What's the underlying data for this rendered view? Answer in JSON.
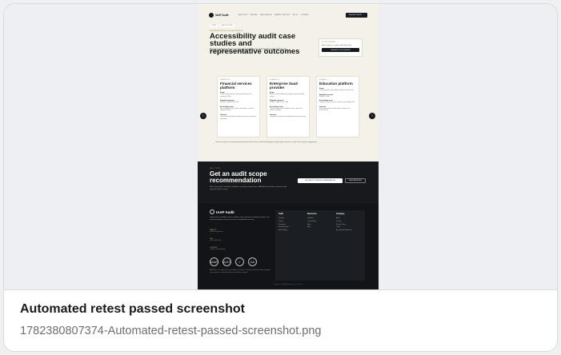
{
  "caption": {
    "title": "Automated retest passed screenshot",
    "filename": "1782380807374-Automated-retest-passed-screenshot.png"
  },
  "site": {
    "nav": {
      "brand": "IAAP Audit",
      "links": [
        "SERVICES",
        "PRICING",
        "RESOURCES",
        "SAMPLE REPORT",
        "BLOG",
        "CONTACT"
      ],
      "cta": "REQUEST AUDIT →"
    },
    "breadcrumbs": [
      "HOME",
      "CASE STUDIES"
    ],
    "hero": {
      "eyebrow": "REPRESENTATIVE ENGAGEMENTS",
      "title": "Accessibility audit case studies and representative outcomes",
      "lede": "Illustrative examples based on recurring engagement types, showing how scope, findings, and remediation planning were typically structured."
    },
    "scope_box": {
      "label": "SCOPE REVIEW",
      "text": "Need a plan for a similar audit? Start here.",
      "button": "REQUEST SCOPE REVIEW"
    },
    "cases": [
      {
        "tag": "EXAMPLE A",
        "title": "Financial services platform",
        "sections": [
          {
            "head": "Scope",
            "body": "Online banking portal, authenticated flows and statement PDFs."
          },
          {
            "head": "Standard assessed",
            "body": "WCAG 2.2 AA, EN 301 549."
          },
          {
            "head": "Key findings areas",
            "body": "Form validation, focus order, data tables, and time-limited sessions."
          },
          {
            "head": "Outcome",
            "body": "Prioritised remediation backlog with owners and retest milestones."
          }
        ]
      },
      {
        "tag": "EXAMPLE B",
        "title": "Enterprise SaaS provider",
        "sections": [
          {
            "head": "Scope",
            "body": "Admin console, dashboard widgets and onboarding wizard."
          },
          {
            "head": "Standard assessed",
            "body": "WCAG 2.2 AA, Section 508."
          },
          {
            "head": "Key findings areas",
            "body": "Custom components, keyboard traps, charts and status messages."
          },
          {
            "head": "Outcome",
            "body": "Component library fixes shipped across product areas."
          }
        ]
      },
      {
        "tag": "EXAMPLE C",
        "title": "Education platform",
        "sections": [
          {
            "head": "Scope",
            "body": "Learning portal, video player and assessment tools."
          },
          {
            "head": "Standard assessed",
            "body": "WCAG 2.2 AA."
          },
          {
            "head": "Key findings areas",
            "body": "Captions, media controls, contrast and reading order."
          },
          {
            "head": "Outcome",
            "body": "Retest passed with conformance summary for procurement."
          }
        ]
      }
    ],
    "footnote": "These scenarios are anonymised and representative of our audit methodology; sample report structure, scope and fit vary by engagement.",
    "cta": {
      "eyebrow": "NEXT STEP",
      "title": "Get an audit scope recommendation",
      "text": "Share the product, standards, deadlines, and report expectations. IAAP Audit will outline a practical audit approach and next steps.",
      "primary": "GET AUDIT SCOPE RECOMMENDATION",
      "secondary": "VIEW SERVICES"
    },
    "footer": {
      "brand": "IAAP Audit",
      "description": "Independent accessibility audits for websites, apps, documents and design systems, with reporting aligned for procurement teams and remediation planning.",
      "contact": [
        {
          "label": "EMAIL US",
          "value": "hello@iaapaudit.com"
        },
        {
          "label": "CALL",
          "value": "+44 20 0000 0000"
        },
        {
          "label": "LOCATION",
          "value": "London, United Kingdom"
        }
      ],
      "badges": [
        "IAAP",
        "A11Y",
        "✓",
        "AA"
      ],
      "note": "IAAP Audit is an independent accessibility consultancy. Credentials referenced reflect individual team members; certification details are available on request.",
      "columns": [
        {
          "head": "Audit",
          "items": [
            "Services",
            "Pricing",
            "Resources",
            "Sample Report",
            "Methodology"
          ]
        },
        {
          "head": "Resources",
          "items": [
            "Guidance",
            "Case Studies",
            "Blog",
            "FAQ"
          ]
        },
        {
          "head": "Company",
          "items": [
            "About",
            "Contact",
            "Privacy Policy",
            "Terms",
            "Accessibility Statement"
          ]
        }
      ],
      "copyright": "Copyright © 2025 IAAP Audit. All rights reserved."
    }
  }
}
